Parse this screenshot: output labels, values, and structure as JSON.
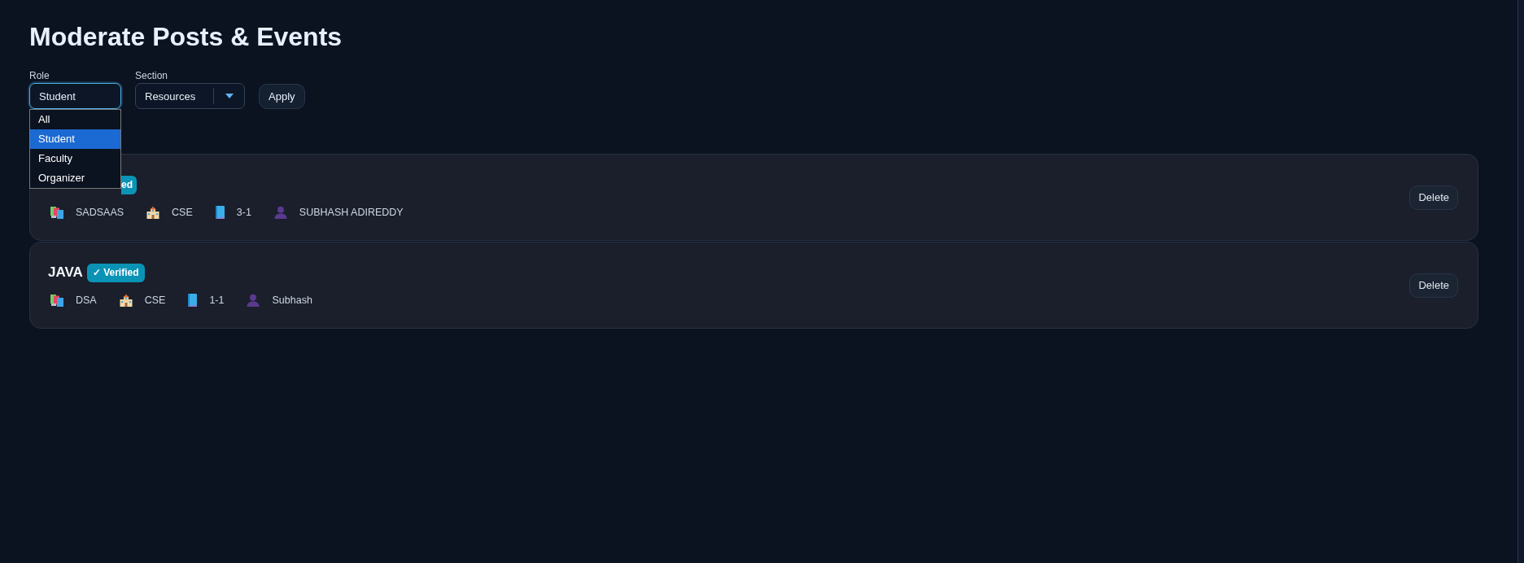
{
  "page": {
    "title": "Moderate Posts & Events"
  },
  "filters": [
    {
      "label": "Role",
      "kind": "listbox",
      "value": "Student",
      "focused": true,
      "expanded": true,
      "options": [
        {
          "label": "All",
          "selected": false
        },
        {
          "label": "Student",
          "selected": true
        },
        {
          "label": "Faculty",
          "selected": false
        },
        {
          "label": "Organizer",
          "selected": false
        }
      ]
    },
    {
      "label": "Section",
      "kind": "combo",
      "value": "Resources",
      "focused": false,
      "expanded": false
    }
  ],
  "apply_button": {
    "label": "Apply"
  },
  "posts": [
    {
      "badge": "ed",
      "meta": [
        {
          "kind": "subject",
          "text": "SADSAAS"
        },
        {
          "kind": "branch",
          "text": "CSE"
        },
        {
          "kind": "year",
          "text": "3-1"
        },
        {
          "kind": "author",
          "text": "SUBHASH ADIREDDY"
        }
      ],
      "delete_button": "Delete"
    },
    {
      "title": "JAVA",
      "badge": "✓ Verified",
      "meta": [
        {
          "kind": "subject",
          "text": "DSA"
        },
        {
          "kind": "branch",
          "text": "CSE"
        },
        {
          "kind": "year",
          "text": "1-1"
        },
        {
          "kind": "author",
          "text": "Subhash"
        }
      ],
      "delete_button": "Delete"
    }
  ]
}
